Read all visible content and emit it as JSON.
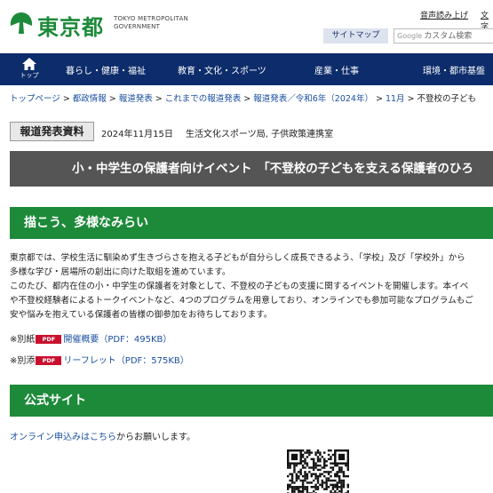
{
  "header": {
    "logo_text": "東京都",
    "logo_en_line1": "TOKYO METROPOLITAN",
    "logo_en_line2": "GOVERNMENT",
    "util_links": [
      "音声読み上げ",
      "文字"
    ],
    "sitemap_label": "サイトマップ",
    "search_brand": "Google",
    "search_placeholder": "カスタム検索",
    "brand_color": "#1d8a3a"
  },
  "nav": {
    "home_label": "トップ",
    "items": [
      "暮らし・健康・福祉",
      "教育・文化・スポーツ",
      "産業・仕事",
      "環境・都市基盤"
    ],
    "bg_color": "#0d2c6b"
  },
  "breadcrumb": {
    "items": [
      "トップページ",
      "都政情報",
      "報道発表",
      "これまでの報道発表",
      "報道発表／令和6年（2024年）",
      "11月"
    ],
    "current": "不登校の子ども"
  },
  "press": {
    "label": "報道発表資料",
    "date": "2024年11月15日",
    "departments": "生活文化スポーツ局, 子供政策連携室"
  },
  "title": "小・中学生の保護者向けイベント　「不登校の子どもを支える保護者のひろ",
  "section1": {
    "heading": "描こう、多様なみらい",
    "lines": [
      "東京都では、学校生活に馴染めず生きづらさを抱える子どもが自分らしく成長できるよう、「学校」及び「学校外」から",
      "多様な学び・居場所の創出に向けた取組を進めています。",
      "このたび、都内在住の小・中学生の保護者を対象として、不登校の子どもの支援に関するイベントを開催します。本イベ",
      "や不登校経験者によるトークイベントなど、4つのプログラムを用意しており、オンラインでも参加可能なプログラムもご",
      "安や悩みを抱えている保護者の皆様の御参加をお待ちしております。"
    ],
    "attachments": [
      {
        "prefix": "※別紙",
        "badge": "PDF",
        "link": "開催概要（PDF：495KB）"
      },
      {
        "prefix": "※別添",
        "badge": "PDF",
        "link": "リーフレット（PDF：575KB）"
      }
    ]
  },
  "section2": {
    "heading": "公式サイト",
    "online_link": "オンライン申込みはこちら",
    "online_suffix": "からお願いします。"
  }
}
